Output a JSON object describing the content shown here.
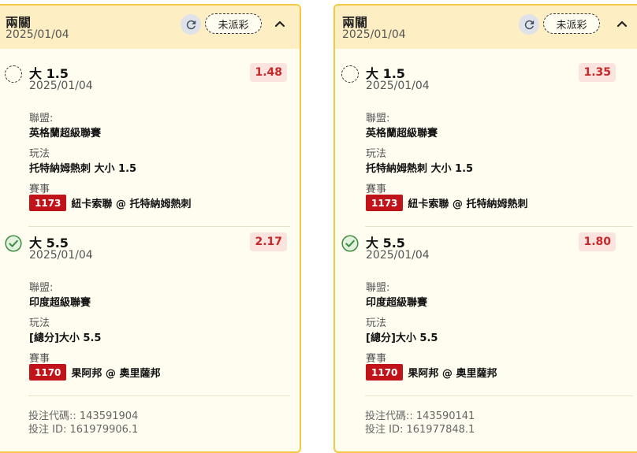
{
  "cards": [
    {
      "title": "兩關",
      "date": "2025/01/04",
      "status": "未派彩",
      "selections": [
        {
          "state": "pending",
          "pick": "大 1.5",
          "date": "2025/01/04",
          "odds": "1.48",
          "league_label": "聯盟:",
          "league": "英格蘭超級聯賽",
          "play_label": "玩法",
          "play": "托特納姆熱刺 大小 1.5",
          "event_label": "賽事",
          "event_id": "1173",
          "event": "紐卡索聯 @ 托特納姆熱刺"
        },
        {
          "state": "won",
          "pick": "大 5.5",
          "date": "2025/01/04",
          "odds": "2.17",
          "league_label": "聯盟:",
          "league": "印度超級聯賽",
          "play_label": "玩法",
          "play": "[總分]大小 5.5",
          "event_label": "賽事",
          "event_id": "1170",
          "event": "果阿邦 @ 奧里薩邦"
        }
      ],
      "bet_code": "投注代碼:: 143591904",
      "bet_id": "投注 ID: 161979906.1"
    },
    {
      "title": "兩關",
      "date": "2025/01/04",
      "status": "未派彩",
      "selections": [
        {
          "state": "pending",
          "pick": "大 1.5",
          "date": "2025/01/04",
          "odds": "1.35",
          "league_label": "聯盟:",
          "league": "英格蘭超級聯賽",
          "play_label": "玩法",
          "play": "托特納姆熱刺 大小 1.5",
          "event_label": "賽事",
          "event_id": "1173",
          "event": "紐卡索聯 @ 托特納姆熱刺"
        },
        {
          "state": "won",
          "pick": "大 5.5",
          "date": "2025/01/04",
          "odds": "1.80",
          "league_label": "聯盟:",
          "league": "印度超級聯賽",
          "play_label": "玩法",
          "play": "[總分]大小 5.5",
          "event_label": "賽事",
          "event_id": "1170",
          "event": "果阿邦 @ 奧里薩邦"
        }
      ],
      "bet_code": "投注代碼:: 143590141",
      "bet_id": "投注 ID: 161977848.1"
    }
  ],
  "colors": {
    "card_bg": "#fffcf0",
    "header_bg": "#fdefc3",
    "border": "#f5c842",
    "odds_text": "#c62828",
    "odds_bg": "#fbe3e0",
    "event_id_bg": "#c0141a",
    "won_green": "#4caf50"
  },
  "icons": {
    "refresh": "refresh-icon",
    "collapse": "chevron-up-icon",
    "pending": "dashed-circle-icon",
    "won": "check-circle-icon"
  }
}
